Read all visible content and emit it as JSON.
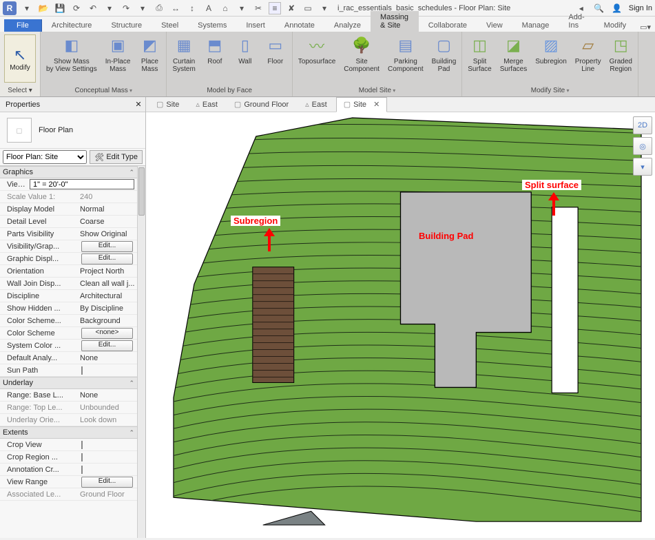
{
  "qat": {
    "title_prefix": "i_rac_essentials_basic_schedules - Floor Plan: Site",
    "signin": "Sign In",
    "logo": "R"
  },
  "tabs": {
    "file": "File",
    "architecture": "Architecture",
    "structure": "Structure",
    "steel": "Steel",
    "systems": "Systems",
    "insert": "Insert",
    "annotate": "Annotate",
    "analyze": "Analyze",
    "massing": "Massing & Site",
    "collaborate": "Collaborate",
    "view": "View",
    "manage": "Manage",
    "addins": "Add-Ins",
    "modify": "Modify"
  },
  "ribbon": {
    "select": "Select ▾",
    "modify": "Modify",
    "conceptual": {
      "title": "Conceptual Mass",
      "showmass": "Show Mass\nby View Settings",
      "inplace": "In-Place\nMass",
      "placemass": "Place\nMass"
    },
    "modelbyface": {
      "title": "Model by Face",
      "curtain": "Curtain\nSystem",
      "roof": "Roof",
      "wall": "Wall",
      "floor": "Floor"
    },
    "modelsite": {
      "title": "Model Site",
      "topo": "Toposurface",
      "sitecomp": "Site\nComponent",
      "parking": "Parking\nComponent",
      "pad": "Building\nPad"
    },
    "modifysite": {
      "title": "Modify Site",
      "split": "Split\nSurface",
      "merge": "Merge\nSurfaces",
      "subregion": "Subregion",
      "propline": "Property\nLine",
      "graded": "Graded\nRegion"
    }
  },
  "properties": {
    "title": "Properties",
    "type_name": "Floor Plan",
    "selector": "Floor Plan: Site",
    "edit_type": "Edit Type",
    "groups": {
      "graphics": "Graphics",
      "underlay": "Underlay",
      "extents": "Extents"
    },
    "rows": {
      "view_scale": "View Scale",
      "view_scale_v": "1\" = 20'-0\"",
      "scale_value": "Scale Value   1:",
      "scale_value_v": "240",
      "display_model": "Display Model",
      "display_model_v": "Normal",
      "detail_level": "Detail Level",
      "detail_level_v": "Coarse",
      "parts_visibility": "Parts Visibility",
      "parts_visibility_v": "Show Original",
      "visibility_overrides": "Visibility/Grap...",
      "graphic_display": "Graphic Displ...",
      "orientation": "Orientation",
      "orientation_v": "Project North",
      "wall_join": "Wall Join Disp...",
      "wall_join_v": "Clean all wall j...",
      "discipline": "Discipline",
      "discipline_v": "Architectural",
      "show_hidden": "Show Hidden ...",
      "show_hidden_v": "By Discipline",
      "color_scheme_loc": "Color Scheme...",
      "color_scheme_loc_v": "Background",
      "color_scheme": "Color Scheme",
      "color_scheme_v": "<none>",
      "system_color": "System Color ...",
      "default_analysis": "Default Analy...",
      "default_analysis_v": "None",
      "sun_path": "Sun Path",
      "range_base": "Range: Base L...",
      "range_base_v": "None",
      "range_top": "Range: Top Le...",
      "range_top_v": "Unbounded",
      "underlay_ori": "Underlay Orie...",
      "underlay_ori_v": "Look down",
      "crop_view": "Crop View",
      "crop_region": "Crop Region ...",
      "annotation_crop": "Annotation Cr...",
      "view_range": "View Range",
      "assoc_level": "Associated Le...",
      "assoc_level_v": "Ground Floor",
      "edit": "Edit..."
    }
  },
  "viewtabs": {
    "site1": "Site",
    "east1": "East",
    "ground": "Ground Floor",
    "east2": "East",
    "site_active": "Site"
  },
  "annotations": {
    "subregion": "Subregion",
    "buildpad": "Building Pad",
    "splitsurf": "Split surface"
  },
  "viewcube": {
    "label": "2D"
  }
}
